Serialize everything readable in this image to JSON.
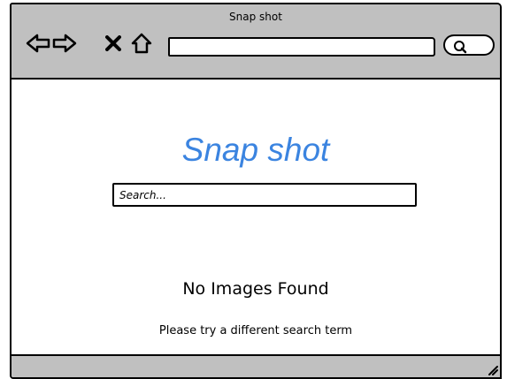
{
  "window": {
    "title": "Snap shot",
    "nav_icons": [
      "back-arrow-icon",
      "forward-arrow-icon",
      "close-icon",
      "home-icon"
    ],
    "address_value": "",
    "search_button_icon": "search-icon"
  },
  "page": {
    "brand": "Snap shot",
    "search": {
      "placeholder": "Search..."
    },
    "empty_state": {
      "title": "No Images Found",
      "subtitle": "Please try a different search term"
    }
  },
  "colors": {
    "chrome": "#c0c0c0",
    "brand": "#3b84e0",
    "outline": "#000000"
  }
}
